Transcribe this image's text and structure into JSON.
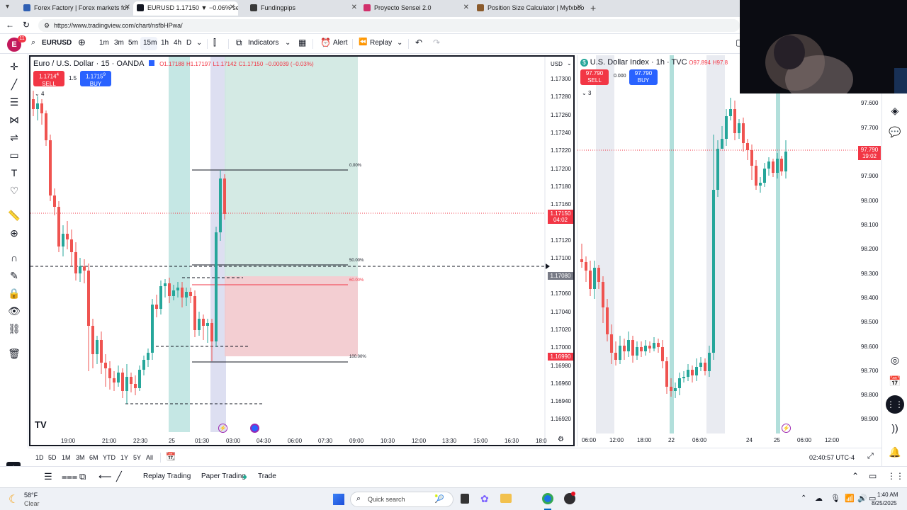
{
  "browser": {
    "tabs": [
      {
        "title": "Forex Factory | Forex markets for",
        "active": false
      },
      {
        "title": "EURUSD 1.17150 ▼ −0.06% se",
        "active": true
      },
      {
        "title": "Fundingpips",
        "active": false
      },
      {
        "title": "Proyecto Sensei 2.0",
        "active": false
      },
      {
        "title": "Position Size Calculator | Myfxboo",
        "active": false
      }
    ],
    "url": "https://www.tradingview.com/chart/nsfbHPwa/",
    "new_tab": "+"
  },
  "toolbar": {
    "avatar_letter": "E",
    "avatar_badge": "11",
    "symbol": "EURUSD",
    "intervals": [
      "1m",
      "3m",
      "5m",
      "15m",
      "1h",
      "4h",
      "D"
    ],
    "active_interval": "15m",
    "indicators_label": "Indicators",
    "alert_label": "Alert",
    "replay_label": "Replay"
  },
  "pane_a": {
    "title": "Euro / U.S. Dollar · 15 · OANDA",
    "ohlc": {
      "o": "O1.17188",
      "h": "H1.17197",
      "l": "L1.17142",
      "c": "C1.17150",
      "chg": "−0.00039 (−0.03%)"
    },
    "sell_price": "1.1714",
    "sell_sup": "4",
    "sell_label": "SELL",
    "spread": "1.5",
    "buy_price": "1.1715",
    "buy_sup": "9",
    "buy_label": "BUY",
    "collapse": "4",
    "currency": "USD",
    "price_ticks": [
      "1.17300",
      "1.17280",
      "1.17260",
      "1.17240",
      "1.17220",
      "1.17200",
      "1.17180",
      "1.17160",
      "1.17120",
      "1.17100",
      "1.17060",
      "1.17040",
      "1.17020",
      "1.17000",
      "1.16980",
      "1.16960",
      "1.16940",
      "1.16920"
    ],
    "time_ticks": [
      "19:00",
      "21:00",
      "22:30",
      "25",
      "01:30",
      "03:00",
      "04:30",
      "06:00",
      "07:30",
      "09:00",
      "10:30",
      "12:00",
      "13:30",
      "15:00",
      "16:30",
      "18:0"
    ],
    "current_price": "1.17150",
    "countdown": "04:02",
    "crosshair_price": "1.17080",
    "red_label_price": "1.16990",
    "fib_levels": [
      "0.00%",
      "50.00%",
      "60.00%",
      "100.00%"
    ],
    "colors": {
      "up": "#26a69a",
      "down": "#ef5350",
      "green_zone": "#cfe8e1",
      "red_zone": "#f2c9cd",
      "session": "#b2dfdb",
      "session2": "#d1d4ec"
    }
  },
  "pane_b": {
    "title": "U.S. Dollar Index · 1h · TVC",
    "ohlc": {
      "o": "O97.894",
      "h": "H97.8"
    },
    "sell_price": "97.790",
    "sell_label": "SELL",
    "spread": "0.000",
    "buy_price": "97.790",
    "buy_label": "BUY",
    "collapse": "3",
    "price_ticks": [
      "97.600",
      "97.700",
      "97.900",
      "98.000",
      "98.100",
      "98.200",
      "98.300",
      "98.400",
      "98.500",
      "98.600",
      "98.700",
      "98.800",
      "98.900"
    ],
    "time_ticks": [
      "06:00",
      "12:00",
      "18:00",
      "22",
      "06:00",
      "24",
      "25",
      "06:00",
      "12:00"
    ],
    "current_price": "97.790",
    "countdown": "19:02"
  },
  "bottom": {
    "ranges": [
      "1D",
      "5D",
      "1M",
      "3M",
      "6M",
      "YTD",
      "1Y",
      "5Y",
      "All"
    ],
    "clock": "02:40:57 UTC-4"
  },
  "panels": {
    "replay_trading": "Replay Trading",
    "paper_trading": "Paper Trading",
    "trade": "Trade"
  },
  "taskbar": {
    "weather_temp": "58°F",
    "weather_cond": "Clear",
    "search_placeholder": "Quick search",
    "time": "1:40 AM",
    "date": "8/25/2025"
  }
}
